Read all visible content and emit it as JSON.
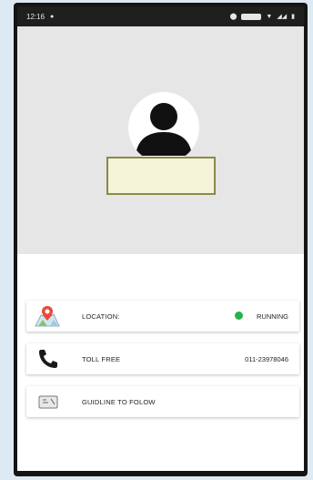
{
  "statusbar": {
    "time": "12:16",
    "dot": "●"
  },
  "colors": {
    "header_bg": "#e6e6e6",
    "running": "#27b24a",
    "name_box": "#f5f3d8"
  },
  "items": [
    {
      "icon": "map-location-icon",
      "label": "LOCATION:",
      "status": "RUNNING"
    },
    {
      "icon": "phone-icon",
      "label": "TOLL FREE",
      "value": "011-23978046"
    },
    {
      "icon": "guideline-icon",
      "label": "GUIDLINE TO FOLOW"
    }
  ]
}
